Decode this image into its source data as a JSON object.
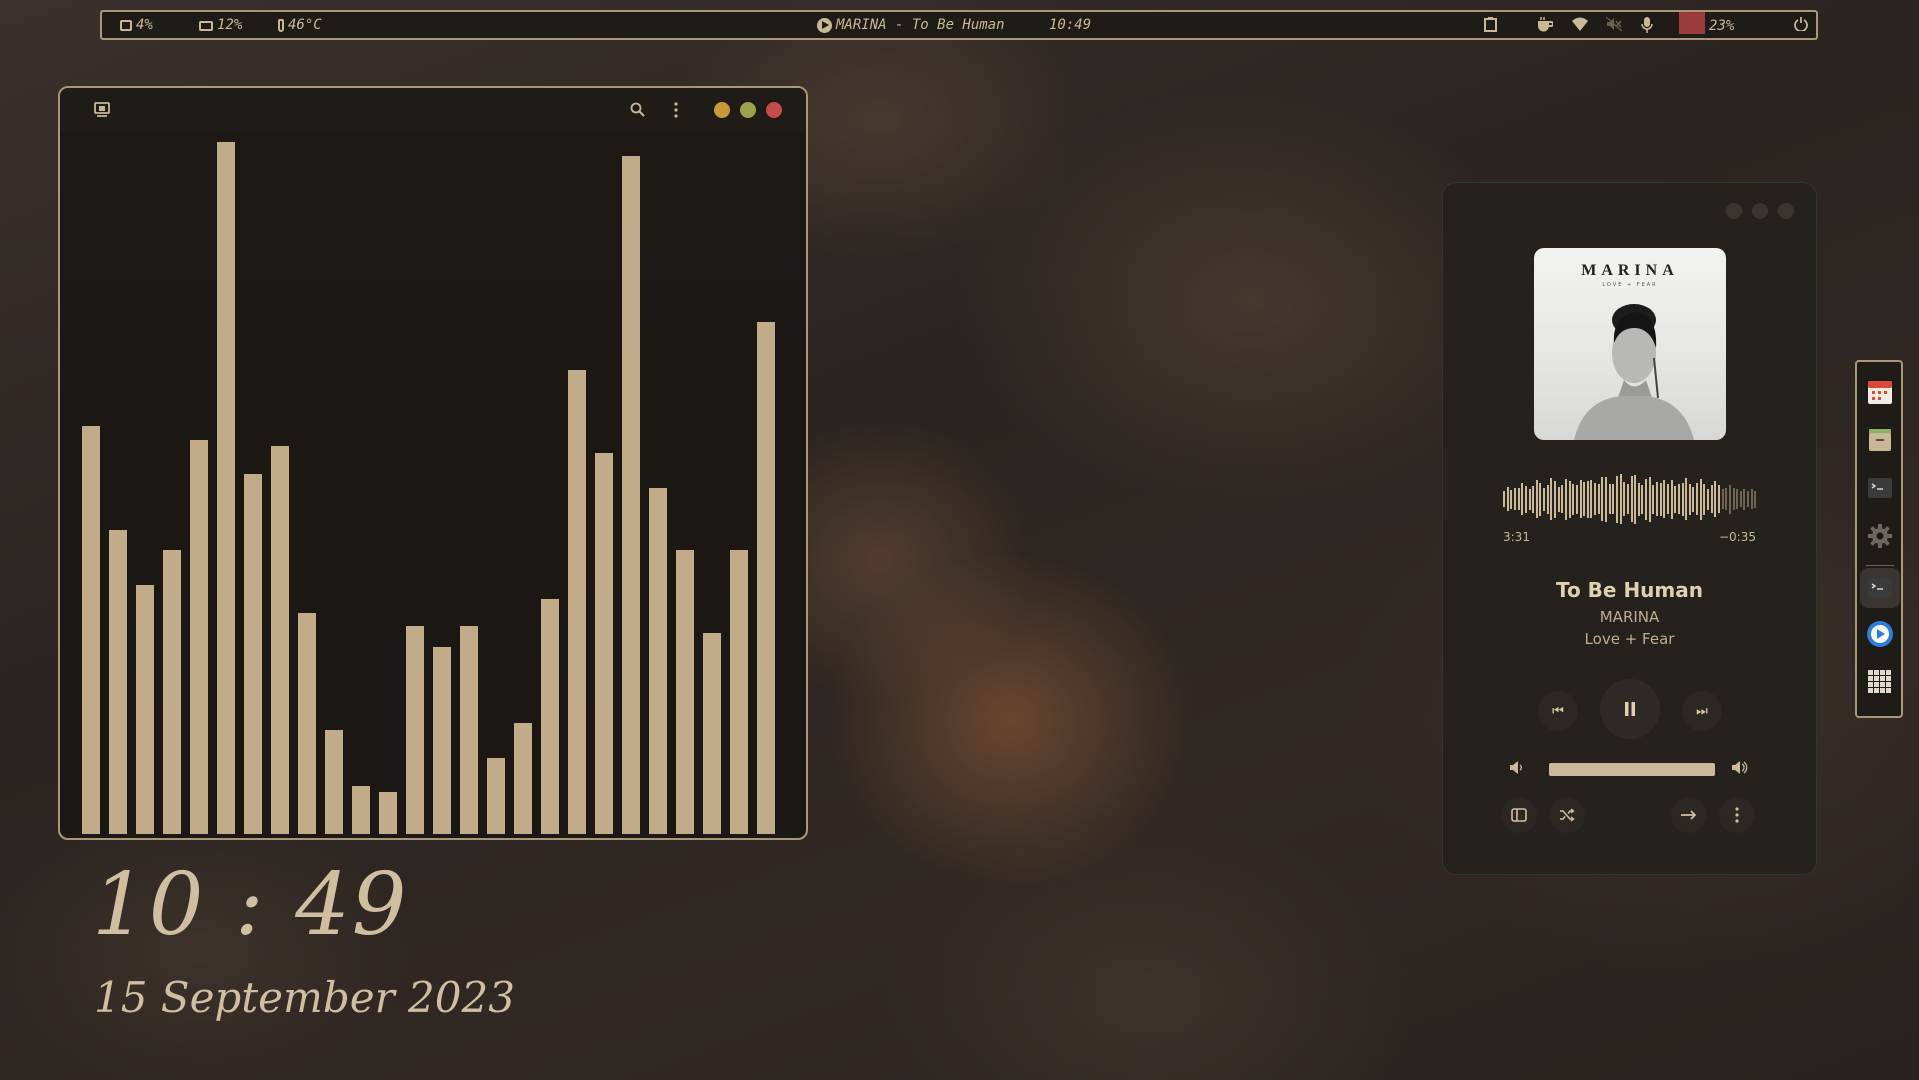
{
  "topbar": {
    "disk_pct": "4%",
    "mem_pct": "12%",
    "temperature": "46°C",
    "now_playing": "MARINA - To Be Human",
    "clock": "10:49",
    "battery_pct": "23%",
    "colors": {
      "battery_low": "#9c3b3b",
      "border": "#a89878"
    }
  },
  "visualizer": {
    "window_dots": [
      "#c9983a",
      "#9aa24a",
      "#c84a4a"
    ],
    "bar_levels": [
      0.59,
      0.44,
      0.36,
      0.41,
      0.57,
      1.0,
      0.52,
      0.56,
      0.32,
      0.15,
      0.07,
      0.06,
      0.3,
      0.27,
      0.3,
      0.11,
      0.16,
      0.34,
      0.67,
      0.55,
      0.98,
      0.5,
      0.41,
      0.29,
      0.41,
      0.74
    ]
  },
  "clock": {
    "time": "10 : 49",
    "date": "15 September 2023"
  },
  "player": {
    "album_art_title": "MARINA",
    "album_art_subtitle": "LOVE + FEAR",
    "elapsed": "3:31",
    "remaining": "−0:35",
    "song_title": "To Be Human",
    "artist": "MARINA",
    "album": "Love + Fear",
    "progress_fraction": 0.86,
    "volume_fraction": 1.0,
    "icons": {
      "prev": "skip-previous-icon",
      "play_pause": "pause-icon",
      "next": "skip-next-icon",
      "volume_low": "volume-low-icon",
      "volume_high": "volume-high-icon",
      "sidebar": "sidebar-icon",
      "shuffle": "shuffle-icon",
      "repeat": "arrow-right-icon",
      "more": "more-vertical-icon"
    }
  },
  "dock": {
    "items": [
      "calendar-icon",
      "files-icon",
      "terminal-icon",
      "settings-icon",
      "terminal-active-icon",
      "media-player-icon",
      "app-grid-icon"
    ]
  }
}
